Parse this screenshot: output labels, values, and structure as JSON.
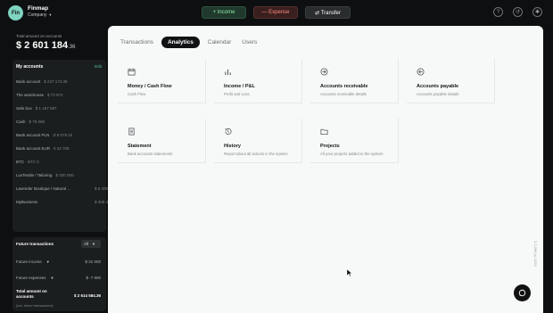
{
  "header": {
    "logo_text": "Fin",
    "app_name": "Finmap",
    "company_label": "Company",
    "buttons": {
      "income": "+ Income",
      "expense": "— Expense",
      "transfer": "⇄ Transfer"
    },
    "icons": [
      "help-icon",
      "history-icon",
      "settings-icon"
    ]
  },
  "sidebar": {
    "total_label": "Total amount on accounts",
    "total_main": "$ 2 601 184",
    "total_cents": ".36",
    "accounts_title": "My accounts",
    "edit_label": "Edit",
    "accounts": [
      {
        "name": "Bank account",
        "amount": "$ 247 174.38"
      },
      {
        "name": "The warehouse",
        "amount": "$ 73 972"
      },
      {
        "name": "Safe box",
        "amount": "$ 1 157 987"
      },
      {
        "name": "Cash",
        "amount": "$ 75 068"
      },
      {
        "name": "Bank account PLN",
        "amount": "zł 8 079.1k"
      },
      {
        "name": "Bank account EUR",
        "amount": "€ 34 708"
      },
      {
        "name": "BTC",
        "amount": "BTC 0"
      },
      {
        "name": "LuxTextile / Tailoring",
        "amount": "$ 200 000"
      },
      {
        "name": "Lavender Boutique / Natural ...",
        "amount": "$ 8 400"
      },
      {
        "name": "MyBusiness",
        "amount": "$ 368 400"
      }
    ],
    "future": {
      "title": "Future transactions",
      "select_value": "All",
      "income_label": "Future income",
      "income_amount": "$ 31 000",
      "expense_label": "Future expenses",
      "expense_amount": "$ -7 600",
      "total_label": "Total amount on accounts",
      "total_value": "$ 2 614 584.36",
      "note": "(incl. future transactions)"
    }
  },
  "main": {
    "tabs": [
      "Transactions",
      "Analytics",
      "Calendar",
      "Users"
    ],
    "active_tab": "Analytics",
    "cards": [
      {
        "title": "Money / Cash Flow",
        "desc": "Cash Flow",
        "icon": "calendar-icon"
      },
      {
        "title": "Income / P&L",
        "desc": "Profit and Loss",
        "icon": "bar-chart-icon"
      },
      {
        "title": "Accounts receivable",
        "desc": "Accounts receivable details",
        "icon": "arrow-in-icon"
      },
      {
        "title": "Accounts payable",
        "desc": "Accounts payable details",
        "icon": "arrow-out-icon"
      },
      {
        "title": "Statement",
        "desc": "Bank accounts statements",
        "icon": "document-icon"
      },
      {
        "title": "History",
        "desc": "Report about all actions in the system",
        "icon": "history-icon"
      },
      {
        "title": "Projects",
        "desc": "All your projects added to the system",
        "icon": "folder-icon"
      }
    ],
    "side_text": "1.2.289 (c) 2022"
  },
  "colors": {
    "page_bg": "#0d0f10",
    "panel_bg": "#1a1e1f",
    "main_bg": "#f7f8f8",
    "accent_green": "#56c6a8",
    "income": "#8fe6a9",
    "expense": "#ff8b7e"
  }
}
